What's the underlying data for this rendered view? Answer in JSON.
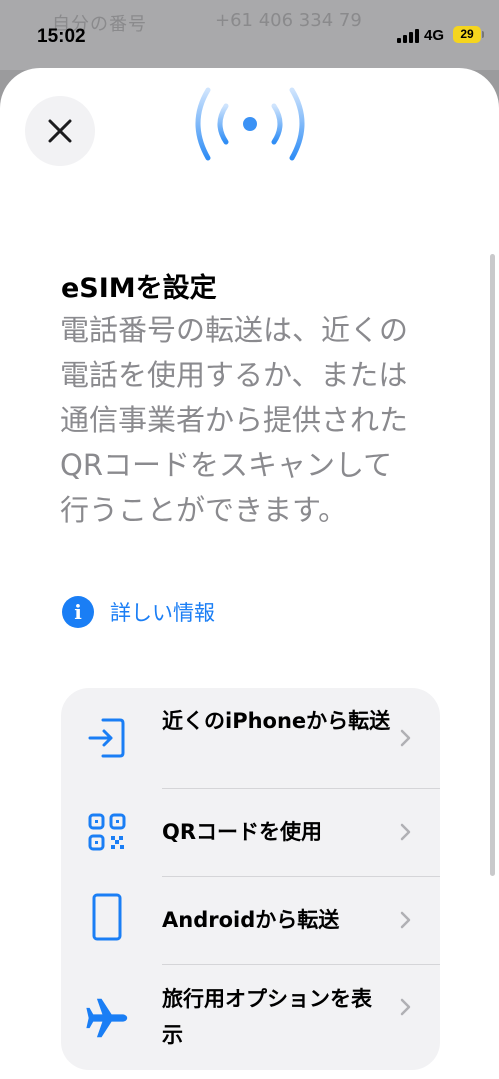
{
  "status_bar": {
    "time": "15:02",
    "network": "4G",
    "battery": "29"
  },
  "background": {
    "row_label": "自分の番号",
    "row_value": "+61 406 334 79"
  },
  "sheet": {
    "title": "eSIMを設定",
    "description": "電話番号の転送は、近くの電話を使用するか、または通信事業者から提供されたQRコードをスキャンして行うことができます。",
    "more_info": "詳しい情報",
    "options": [
      {
        "label": "近くのiPhoneから転送",
        "icon": "transfer-in-icon"
      },
      {
        "label": "QRコードを使用",
        "icon": "qr-code-icon"
      },
      {
        "label": "Androidから転送",
        "icon": "phone-icon"
      },
      {
        "label": "旅行用オプションを表示",
        "icon": "airplane-icon"
      }
    ]
  },
  "colors": {
    "accent": "#1a7ef5",
    "secondary_text": "#8a8a8e",
    "card_bg": "#f2f2f4"
  }
}
